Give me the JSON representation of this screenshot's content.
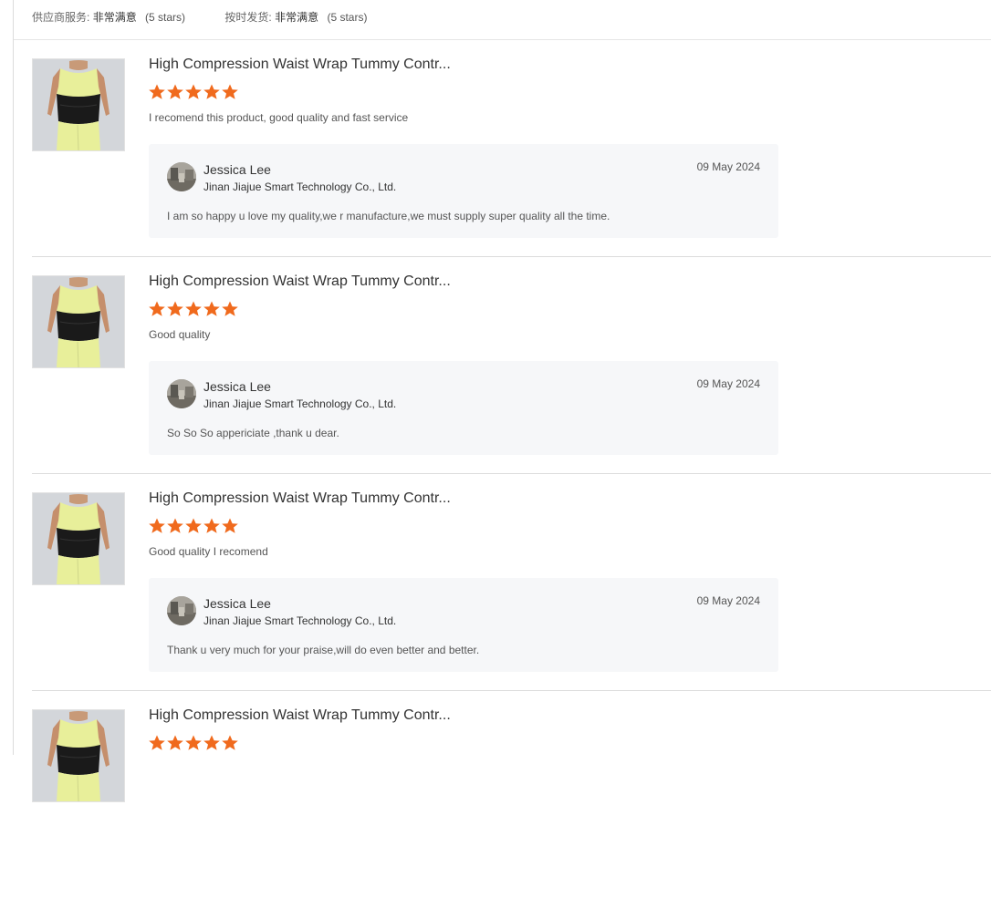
{
  "summary": {
    "supplier_service_label": "供应商服务:",
    "supplier_service_value": "非常满意",
    "supplier_service_stars": "(5 stars)",
    "on_time_label": "按时发货:",
    "on_time_value": "非常满意",
    "on_time_stars": "(5 stars)"
  },
  "colors": {
    "star": "#f06a1d",
    "reply_bg": "#f6f7f9",
    "divider": "#dcdcdc"
  },
  "reviews": [
    {
      "product_title": "High Compression Waist Wrap Tummy Contr...",
      "rating": 5,
      "comment": "I recomend this product, good quality and fast service",
      "reply": {
        "seller_name": "Jessica Lee",
        "company": "Jinan Jiajue Smart Technology Co., Ltd.",
        "date": "09 May 2024",
        "text": "I am so happy u love my quality,we r manufacture,we must supply super quality all the time."
      }
    },
    {
      "product_title": "High Compression Waist Wrap Tummy Contr...",
      "rating": 5,
      "comment": "Good quality",
      "reply": {
        "seller_name": "Jessica Lee",
        "company": "Jinan Jiajue Smart Technology Co., Ltd.",
        "date": "09 May 2024",
        "text": "So So So appericiate ,thank u dear."
      }
    },
    {
      "product_title": "High Compression Waist Wrap Tummy Contr...",
      "rating": 5,
      "comment": "Good quality I recomend",
      "reply": {
        "seller_name": "Jessica Lee",
        "company": "Jinan Jiajue Smart Technology Co., Ltd.",
        "date": "09 May 2024",
        "text": "Thank u very much for your praise,will do even better and better."
      }
    },
    {
      "product_title": "High Compression Waist Wrap Tummy Contr...",
      "rating": 5
    }
  ]
}
